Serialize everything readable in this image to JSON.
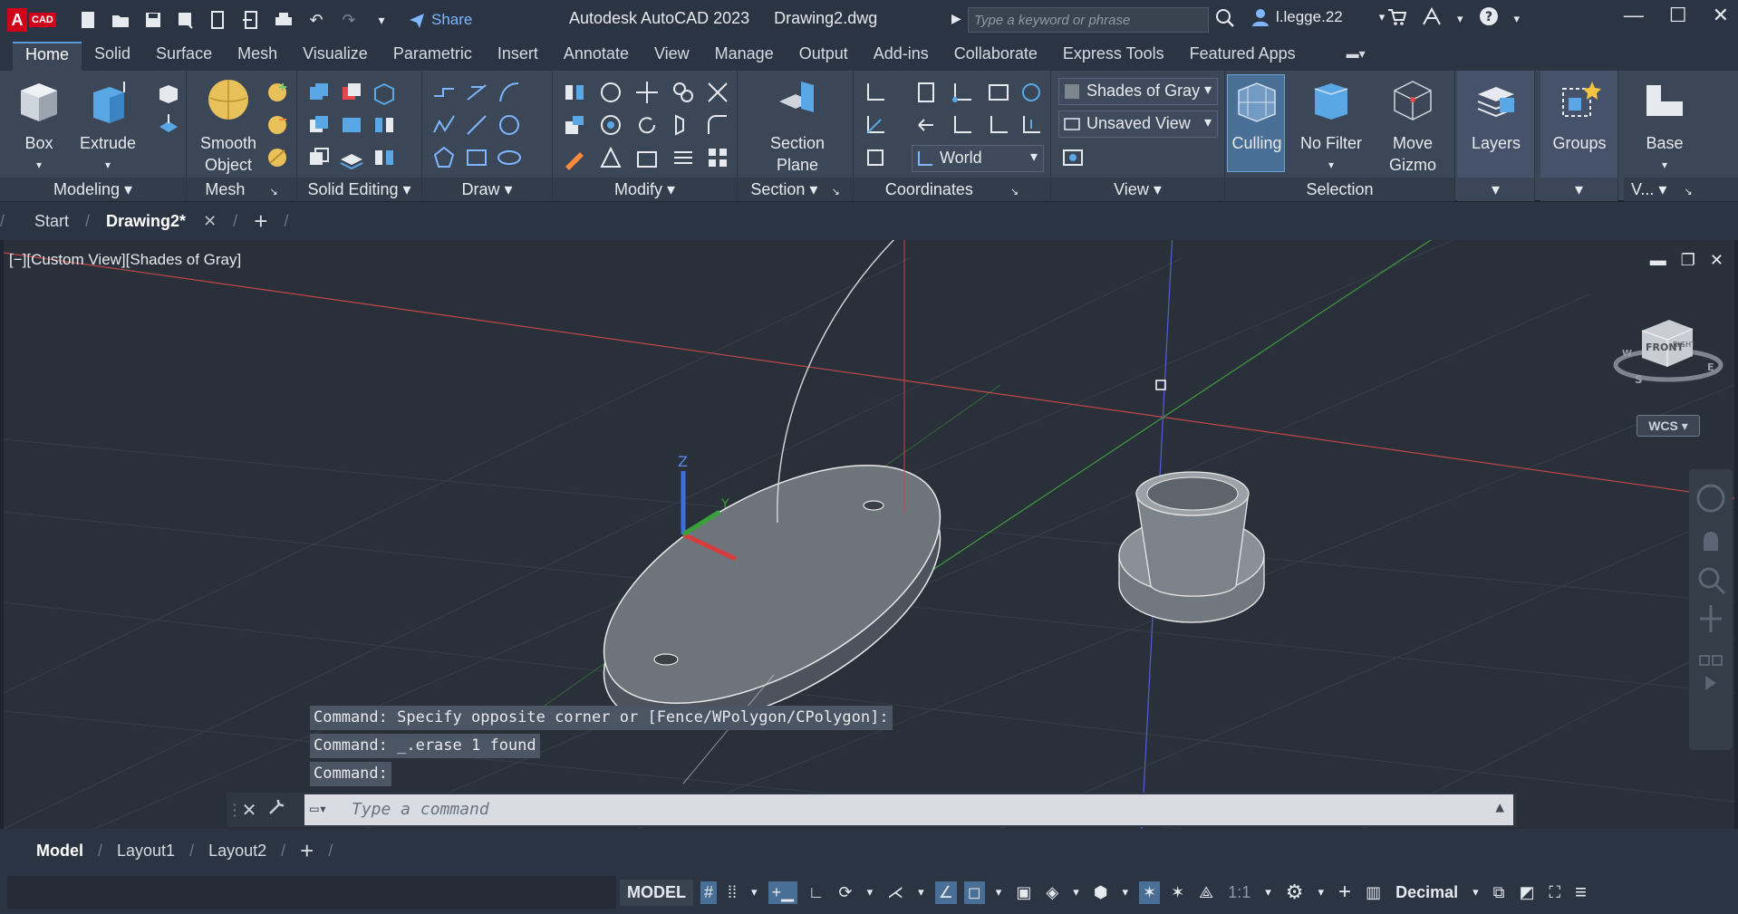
{
  "titlebar": {
    "logo_letter": "A",
    "logo_tag": "CAD",
    "share_label": "Share",
    "app_title": "Autodesk AutoCAD 2023",
    "doc_title": "Drawing2.dwg",
    "search_placeholder": "Type a keyword or phrase",
    "user_name": "l.legge.22"
  },
  "ribbon_tabs": [
    "Home",
    "Solid",
    "Surface",
    "Mesh",
    "Visualize",
    "Parametric",
    "Insert",
    "Annotate",
    "View",
    "Manage",
    "Output",
    "Add-ins",
    "Collaborate",
    "Express Tools",
    "Featured Apps"
  ],
  "ribbon": {
    "box_label": "Box",
    "extrude_label": "Extrude",
    "smooth_label_1": "Smooth",
    "smooth_label_2": "Object",
    "section_label_1": "Section",
    "section_label_2": "Plane",
    "visual_style": "Shades of Gray",
    "view_name": "Unsaved View",
    "ucs_name": "World",
    "culling_label": "Culling",
    "nofilter_label": "No Filter",
    "movegizmo_1": "Move",
    "movegizmo_2": "Gizmo",
    "layers_label": "Layers",
    "groups_label": "Groups",
    "base_label": "Base",
    "panels": {
      "modeling": "Modeling",
      "mesh": "Mesh",
      "solid_editing": "Solid Editing",
      "draw": "Draw",
      "modify": "Modify",
      "section": "Section",
      "coordinates": "Coordinates",
      "view": "View",
      "selection": "Selection",
      "v": "V..."
    }
  },
  "doc_tabs": {
    "start": "Start",
    "active": "Drawing2*"
  },
  "viewport": {
    "label": "[−][Custom View][Shades of Gray]",
    "wcs": "WCS",
    "viewcube_face": "FRONT",
    "viewcube_right": "RIGHT",
    "compass_s": "S",
    "compass_w": "W",
    "compass_e": "E",
    "ucs_z": "Z",
    "ucs_y": "Y"
  },
  "command": {
    "history": [
      "Command: Specify opposite corner or [Fence/WPolygon/CPolygon]:",
      "Command: _.erase 1 found",
      "Command:"
    ],
    "placeholder": "Type a command"
  },
  "layout_tabs": [
    "Model",
    "Layout1",
    "Layout2"
  ],
  "status": {
    "model": "MODEL",
    "scale": "1:1",
    "units": "Decimal"
  }
}
